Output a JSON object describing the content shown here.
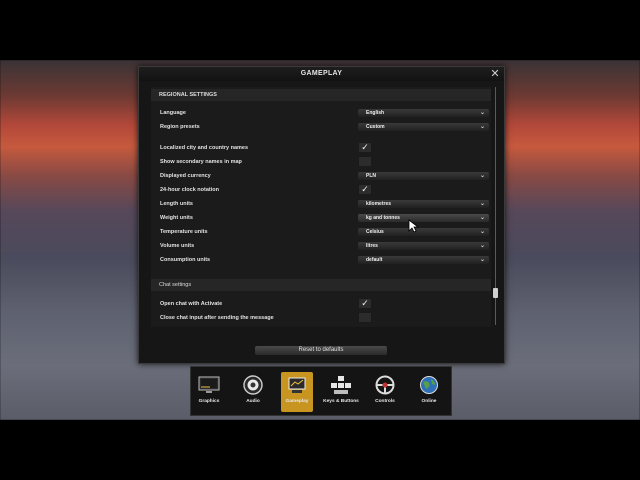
{
  "dialog": {
    "title": "GAMEPLAY",
    "close": "✕"
  },
  "regional": {
    "header": "REGIONAL SETTINGS",
    "language": {
      "label": "Language",
      "value": "English"
    },
    "region_presets": {
      "label": "Region presets",
      "value": "Custom"
    },
    "localized_names": {
      "label": "Localized city and country names",
      "checked": true
    },
    "secondary_names": {
      "label": "Show secondary names in map",
      "checked": false
    },
    "currency": {
      "label": "Displayed currency",
      "value": "PLN"
    },
    "clock": {
      "label": "24-hour clock notation",
      "checked": true
    },
    "length": {
      "label": "Length units",
      "value": "kilometres"
    },
    "weight": {
      "label": "Weight units",
      "value": "kg and tonnes"
    },
    "temperature": {
      "label": "Temperature units",
      "value": "Celsius"
    },
    "volume": {
      "label": "Volume units",
      "value": "litres"
    },
    "consumption": {
      "label": "Consumption units",
      "value": "default"
    }
  },
  "chat": {
    "header": "Chat settings",
    "open_chat": {
      "label": "Open chat with Activate",
      "checked": true
    },
    "close_chat": {
      "label": "Close chat input after sending the message",
      "checked": false
    }
  },
  "reset_button": "Reset to defaults",
  "tabs": [
    {
      "label": "Graphics",
      "icon": "monitor-icon",
      "active": false
    },
    {
      "label": "Audio",
      "icon": "speaker-icon",
      "active": false
    },
    {
      "label": "Gameplay",
      "icon": "gameplay-icon",
      "active": true
    },
    {
      "label": "Keys & Buttons",
      "icon": "keyboard-icon",
      "active": false
    },
    {
      "label": "Controls",
      "icon": "steering-wheel-icon",
      "active": false
    },
    {
      "label": "Online",
      "icon": "globe-icon",
      "active": false
    }
  ],
  "colors": {
    "accent": "#c79520",
    "panel": "#161616"
  },
  "chevron": "⌄",
  "check": "✓"
}
